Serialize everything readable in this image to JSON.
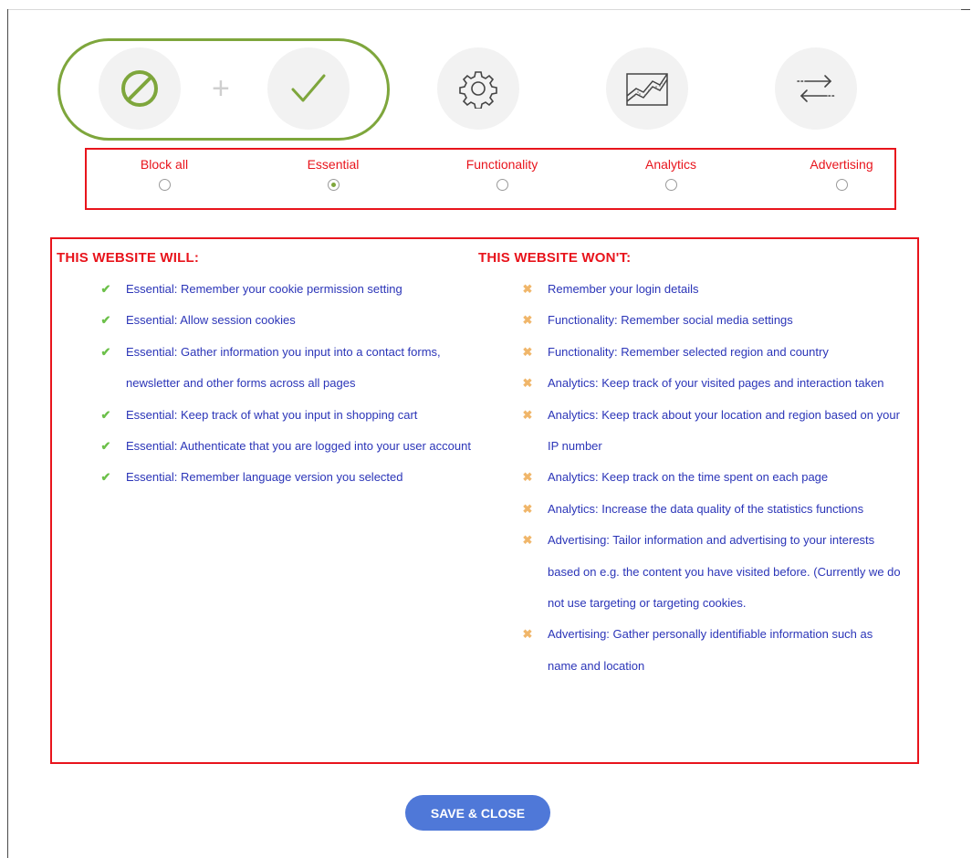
{
  "icons": {
    "block": "block-icon",
    "essential": "checkmark-icon",
    "functionality": "gear-icon",
    "analytics": "chart-icon",
    "advertising": "arrows-exchange-icon",
    "plus": "+"
  },
  "colors": {
    "accent_green": "#7ea63c",
    "highlight_red": "#e8141c",
    "link_blue": "#2b35b8",
    "check_green": "#6cc04a",
    "cross_orange": "#f0b66a",
    "button_blue": "#4f78d8"
  },
  "levels": [
    {
      "label": "Block all",
      "selected": false
    },
    {
      "label": "Essential",
      "selected": true
    },
    {
      "label": "Functionality",
      "selected": false
    },
    {
      "label": "Analytics",
      "selected": false
    },
    {
      "label": "Advertising",
      "selected": false
    }
  ],
  "will": {
    "title": "THIS WEBSITE WILL:",
    "items": [
      {
        "mark": "✔",
        "text": "Essential: Remember your cookie permission setting"
      },
      {
        "mark": "✔",
        "text": "Essential: Allow session cookies"
      },
      {
        "mark": "✔",
        "text": "Essential: Gather information you input into a contact forms, newsletter and other forms across all pages"
      },
      {
        "mark": "✔",
        "text": "Essential: Keep track of what you input in shopping cart"
      },
      {
        "mark": "✔",
        "text": "Essential: Authenticate that you are logged into your user account"
      },
      {
        "mark": "✔",
        "text": "Essential: Remember language version you selected"
      }
    ]
  },
  "wont": {
    "title": "THIS WEBSITE WON'T:",
    "items": [
      {
        "mark": "✖",
        "text": "Remember your login details"
      },
      {
        "mark": "✖",
        "text": "Functionality: Remember social media settings"
      },
      {
        "mark": "✖",
        "text": "Functionality: Remember selected region and country"
      },
      {
        "mark": "✖",
        "text": "Analytics: Keep track of your visited pages and interaction taken"
      },
      {
        "mark": "✖",
        "text": "Analytics: Keep track about your location and region based on your IP number"
      },
      {
        "mark": "✖",
        "text": "Analytics: Keep track on the time spent on each page"
      },
      {
        "mark": "✖",
        "text": "Analytics: Increase the data quality of the statistics functions"
      },
      {
        "mark": "✖",
        "text": "Advertising: Tailor information and advertising to your interests based on e.g. the content you have visited before. (Currently we do not use targeting or targeting cookies."
      },
      {
        "mark": "✖",
        "text": "Advertising: Gather personally identifiable information such as name and location"
      }
    ]
  },
  "save_button": {
    "label": "SAVE & CLOSE"
  }
}
